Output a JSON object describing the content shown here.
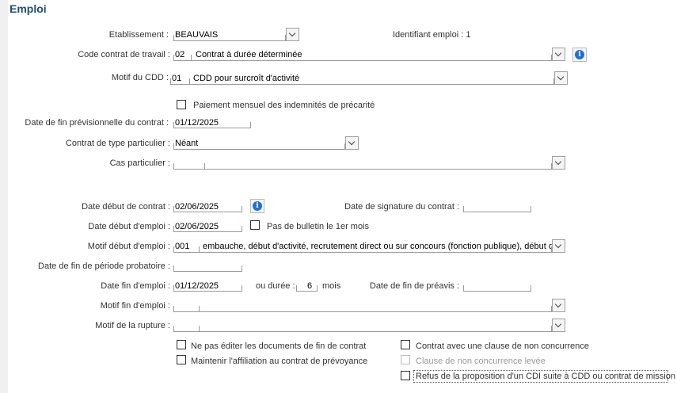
{
  "section_title": "Emploi",
  "etablissement": {
    "label": "Etablissement :",
    "value": "BEAUVAIS"
  },
  "identifiant": {
    "text": "Identifiant emploi : 1"
  },
  "code_contrat": {
    "label": "Code contrat de travail :",
    "code": "02",
    "value": "Contrat à durée déterminée"
  },
  "motif_cdd": {
    "label": "Motif du CDD :",
    "code": "01",
    "value": "CDD pour surcroît d'activité"
  },
  "paiement_mensuel": {
    "label": "Paiement mensuel des indemnités de précarité",
    "checked": false
  },
  "date_fin_previsionnelle": {
    "label": "Date de fin prévisionnelle du contrat :",
    "value": "01/12/2025"
  },
  "contrat_type_particulier": {
    "label": "Contrat de type particulier :",
    "value": "Néant"
  },
  "cas_particulier": {
    "label": "Cas particulier :",
    "value": ""
  },
  "date_debut_contrat": {
    "label": "Date début de contrat :",
    "value": "02/06/2025"
  },
  "date_signature": {
    "label": "Date de signature du contrat :",
    "value": ""
  },
  "date_debut_emploi": {
    "label": "Date début d'emploi :",
    "value": "02/06/2025"
  },
  "pas_de_bulletin": {
    "label": "Pas de bulletin le 1er mois",
    "checked": false
  },
  "motif_debut_emploi": {
    "label": "Motif début d'emploi :",
    "code": "001",
    "value": "embauche, début d'activité, recrutement direct ou sur concours (fonction publique), début de c"
  },
  "date_fin_periode_probatoire": {
    "label": "Date de fin de période probatoire :",
    "value": ""
  },
  "date_fin_emploi": {
    "label": "Date fin d'emploi :",
    "value": "01/12/2025",
    "ou_duree": "ou durée :",
    "duree": "6",
    "mois": "mois"
  },
  "date_fin_preavis": {
    "label": "Date de fin de préavis :",
    "value": ""
  },
  "motif_fin_emploi": {
    "label": "Motif fin d'emploi :",
    "value": ""
  },
  "motif_rupture": {
    "label": "Motif de la rupture :",
    "value": ""
  },
  "checkboxes": {
    "ne_pas_editer": "Ne pas éditer les documents de fin de contrat",
    "maintenir_affiliation": "Maintenir l'affiliation au contrat de prévoyance",
    "clause_non_concurrence": "Contrat avec une clause de non concurrence",
    "clause_levee": "Clause de non concurrence levée",
    "refus_cdi": "Refus de la proposition d'un CDI suite à CDD ou contrat de mission"
  },
  "colors": {
    "title": "#1f4e79",
    "info": "#1f6fd6"
  }
}
